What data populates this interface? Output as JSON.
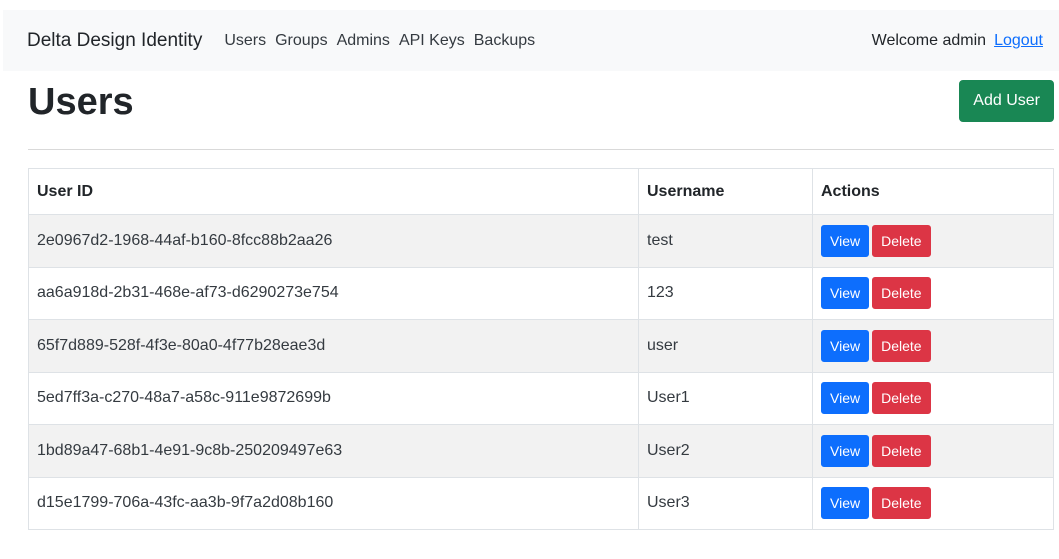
{
  "navbar": {
    "brand": "Delta Design Identity",
    "links": [
      "Users",
      "Groups",
      "Admins",
      "API Keys",
      "Backups"
    ],
    "welcome": "Welcome admin",
    "logout": "Logout"
  },
  "header": {
    "title": "Users",
    "add_button": "Add User"
  },
  "table": {
    "columns": [
      "User ID",
      "Username",
      "Actions"
    ],
    "view_label": "View",
    "delete_label": "Delete",
    "rows": [
      {
        "id": "2e0967d2-1968-44af-b160-8fcc88b2aa26",
        "username": "test"
      },
      {
        "id": "aa6a918d-2b31-468e-af73-d6290273e754",
        "username": "123"
      },
      {
        "id": "65f7d889-528f-4f3e-80a0-4f77b28eae3d",
        "username": "user"
      },
      {
        "id": "5ed7ff3a-c270-48a7-a58c-911e9872699b",
        "username": "User1"
      },
      {
        "id": "1bd89a47-68b1-4e91-9c8b-250209497e63",
        "username": "User2"
      },
      {
        "id": "d15e1799-706a-43fc-aa3b-9f7a2d08b160",
        "username": "User3"
      }
    ]
  },
  "colors": {
    "navbar_bg": "#f8f9fa",
    "add_button": "#198754",
    "view_button": "#0d6efd",
    "delete_button": "#dc3545",
    "link": "#0d6efd"
  }
}
